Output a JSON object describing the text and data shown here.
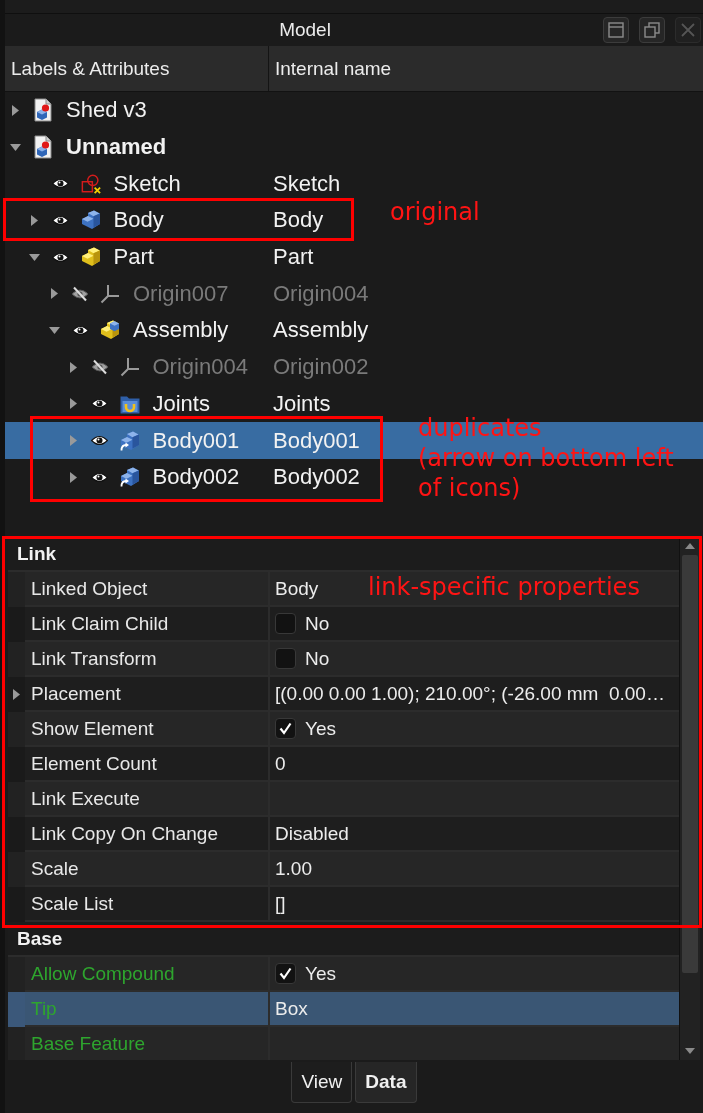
{
  "panel": {
    "title": "Model",
    "title_buttons": [
      {
        "kind": "float",
        "disabled": false
      },
      {
        "kind": "restore",
        "disabled": false
      },
      {
        "kind": "close",
        "disabled": true
      }
    ]
  },
  "tree": {
    "columns": [
      "Labels & Attributes",
      "Internal name"
    ],
    "items": [
      {
        "label": "Shed v3",
        "kind": "document",
        "expanded": false,
        "active": false,
        "selected": false
      },
      {
        "label": "Unnamed",
        "kind": "document",
        "expanded": true,
        "active": true,
        "selected": false,
        "children": [
          {
            "label": "Sketch",
            "internal_name": "Sketch",
            "kind": "sketch",
            "visible": true,
            "selected": false
          },
          {
            "label": "Body",
            "internal_name": "Body",
            "kind": "body",
            "expanded": false,
            "visible": true,
            "selected": false
          },
          {
            "label": "Part",
            "internal_name": "Part",
            "kind": "part",
            "expanded": true,
            "visible": true,
            "selected": false,
            "children": [
              {
                "label": "Origin007",
                "internal_name": "Origin004",
                "kind": "origin",
                "expanded": false,
                "visible": false,
                "selected": false
              },
              {
                "label": "Assembly",
                "internal_name": "Assembly",
                "kind": "assembly",
                "expanded": true,
                "visible": true,
                "selected": false,
                "children": [
                  {
                    "label": "Origin004",
                    "internal_name": "Origin002",
                    "kind": "origin",
                    "expanded": false,
                    "visible": false,
                    "selected": false
                  },
                  {
                    "label": "Joints",
                    "internal_name": "Joints",
                    "kind": "joints",
                    "expanded": false,
                    "visible": true,
                    "selected": false
                  },
                  {
                    "label": "Body001",
                    "internal_name": "Body001",
                    "kind": "body-link",
                    "expanded": false,
                    "visible": true,
                    "selected": true
                  },
                  {
                    "label": "Body002",
                    "internal_name": "Body002",
                    "kind": "body-link",
                    "expanded": false,
                    "visible": true,
                    "selected": false
                  }
                ]
              }
            ]
          }
        ]
      }
    ]
  },
  "properties": {
    "groups": [
      {
        "name": "Link",
        "rows": [
          {
            "name": "Linked Object",
            "kind": "text",
            "value": "Body",
            "color": "#e8e8e8",
            "selected": false
          },
          {
            "name": "Link Claim Child",
            "kind": "checkbox",
            "checked": false,
            "value": "No",
            "color": "#e8e8e8",
            "selected": false
          },
          {
            "name": "Link Transform",
            "kind": "checkbox",
            "checked": false,
            "value": "No",
            "color": "#e8e8e8",
            "selected": false
          },
          {
            "name": "Placement",
            "kind": "text",
            "expanded": false,
            "value": "[(0.00 0.00 1.00); 210.00°; (-26.00 mm  0.00…",
            "color": "#e8e8e8",
            "selected": false
          },
          {
            "name": "Show Element",
            "kind": "checkbox",
            "checked": true,
            "value": "Yes",
            "color": "#e8e8e8",
            "selected": false
          },
          {
            "name": "Element Count",
            "kind": "text",
            "value": "0",
            "color": "#e8e8e8",
            "selected": false
          },
          {
            "name": "Link Execute",
            "kind": "text",
            "color": "#e8e8e8",
            "selected": false
          },
          {
            "name": "Link Copy On Change",
            "kind": "text",
            "value": "Disabled",
            "color": "#e8e8e8",
            "selected": false
          },
          {
            "name": "Scale",
            "kind": "text",
            "value": "1.00",
            "color": "#e8e8e8",
            "selected": false
          },
          {
            "name": "Scale List",
            "kind": "text",
            "value": "[]",
            "color": "#e8e8e8",
            "selected": false
          }
        ]
      },
      {
        "name": "Base",
        "rows": [
          {
            "name": "Allow Compound",
            "kind": "checkbox",
            "checked": true,
            "value": "Yes",
            "color": "#2ea52e",
            "selected": false
          },
          {
            "name": "Tip",
            "kind": "text",
            "value": "Box",
            "color": "#2ea52e",
            "selected": true
          },
          {
            "name": "Base Feature",
            "kind": "text",
            "color": "#2ea52e",
            "selected": false
          }
        ]
      }
    ]
  },
  "tabs": [
    {
      "label": "View",
      "selected": false
    },
    {
      "label": "Data",
      "selected": true
    }
  ],
  "annotations": [
    {
      "text": "original"
    },
    {
      "text": "duplicates\n(arrow on bottom left\nof icons)"
    },
    {
      "text": "link-specific properties"
    }
  ]
}
